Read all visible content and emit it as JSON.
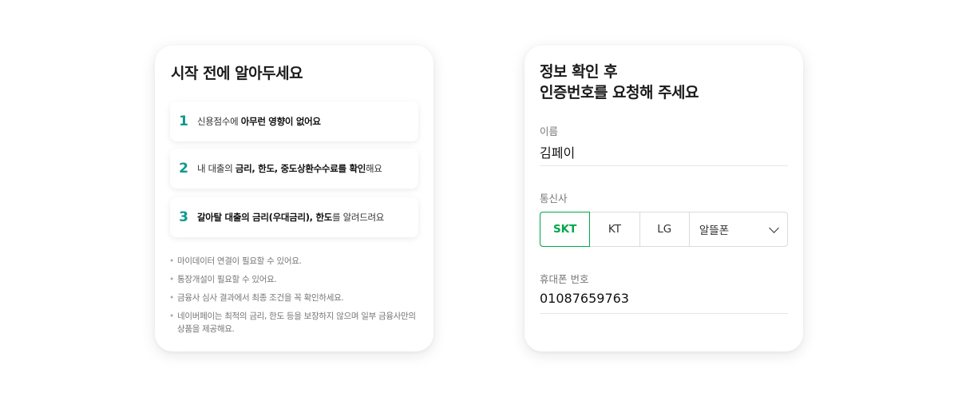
{
  "left_card": {
    "title": "시작 전에 알아두세요",
    "steps": [
      {
        "num": "1",
        "pre": "신용점수에 ",
        "bold": "아무런 영향이 없어요",
        "post": ""
      },
      {
        "num": "2",
        "pre": "내 대출의 ",
        "bold": "금리, 한도, 중도상환수수료를 확인",
        "post": "해요"
      },
      {
        "num": "3",
        "pre": "",
        "bold": "갈아탈 대출의 금리(우대금리), 한도",
        "post": "를 알려드려요"
      }
    ],
    "notes": [
      "마이데이터 연결이 필요할 수 있어요.",
      "통장개설이 필요할 수 있어요.",
      "금융사 심사 결과에서 최종 조건을 꼭 확인하세요.",
      "네이버페이는 최적의 금리, 한도 등을 보장하지 않으며 일부 금융사만의 상품을 제공해요."
    ],
    "bullet": "•"
  },
  "right_card": {
    "title_line1": "정보 확인 후",
    "title_line2": "인증번호를 요청해 주세요",
    "name_label": "이름",
    "name_value": "김페이",
    "carrier_label": "통신사",
    "carriers": [
      "SKT",
      "KT",
      "LG",
      "알뜰폰"
    ],
    "selected_carrier": "SKT",
    "phone_label": "휴대폰 번호",
    "phone_value": "01087659763"
  },
  "colors": {
    "step_number": "#0d9a8f",
    "selected_carrier": "#03a64a"
  }
}
